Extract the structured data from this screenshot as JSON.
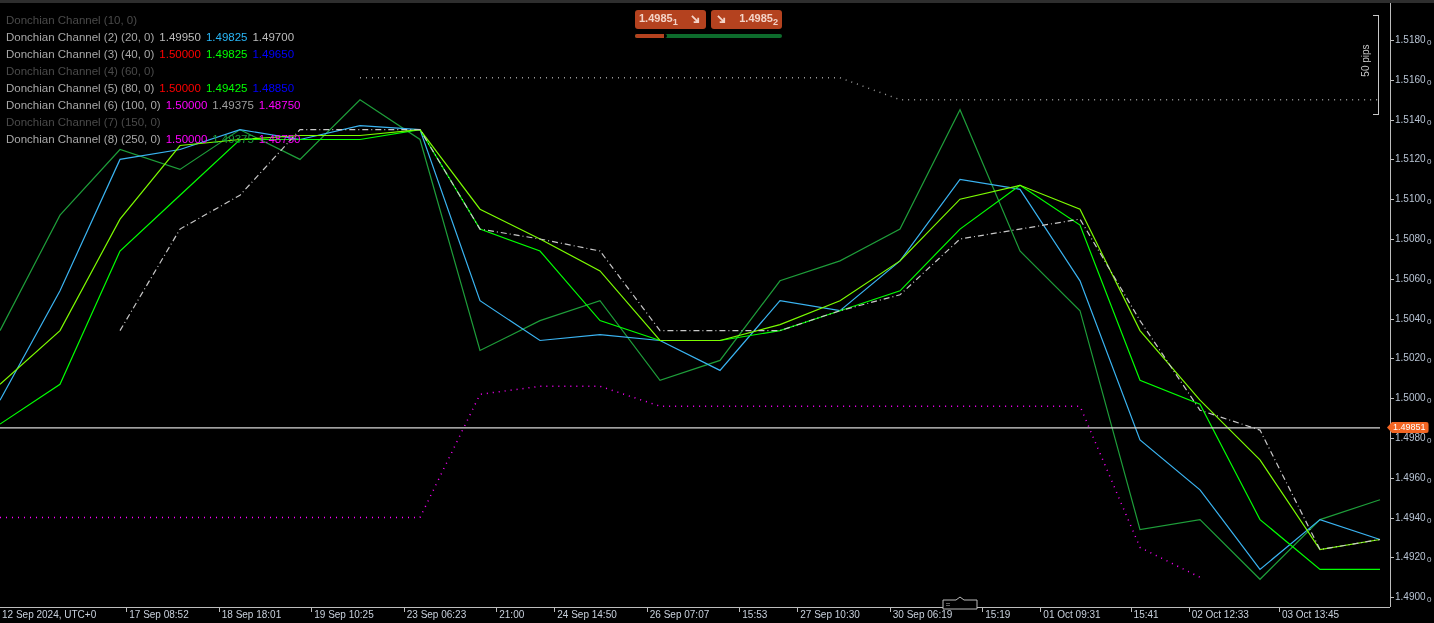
{
  "legend": [
    {
      "label": "Donchian Channel (10, 0)",
      "hidden": true
    },
    {
      "label": "Donchian Channel (2) (20, 0)",
      "hidden": false,
      "values": [
        {
          "text": "1.49950",
          "color": "#bdbdbd"
        },
        {
          "text": "1.49825",
          "color": "#29b6f6"
        },
        {
          "text": "1.49700",
          "color": "#bdbdbd"
        }
      ]
    },
    {
      "label": "Donchian Channel (3) (40, 0)",
      "hidden": false,
      "values": [
        {
          "text": "1.50000",
          "color": "#ff0000"
        },
        {
          "text": "1.49825",
          "color": "#00ff00"
        },
        {
          "text": "1.49650",
          "color": "#0000ff"
        }
      ]
    },
    {
      "label": "Donchian Channel (4) (60, 0)",
      "hidden": true
    },
    {
      "label": "Donchian Channel (5) (80, 0)",
      "hidden": false,
      "values": [
        {
          "text": "1.50000",
          "color": "#ff0000"
        },
        {
          "text": "1.49425",
          "color": "#00ff00"
        },
        {
          "text": "1.48850",
          "color": "#0000ff"
        }
      ]
    },
    {
      "label": "Donchian Channel (6) (100, 0)",
      "hidden": false,
      "values": [
        {
          "text": "1.50000",
          "color": "#ff00ff"
        },
        {
          "text": "1.49375",
          "color": "#9e9e9e"
        },
        {
          "text": "1.48750",
          "color": "#ff00ff"
        }
      ]
    },
    {
      "label": "Donchian Channel (7) (150, 0)",
      "hidden": true
    },
    {
      "label": "Donchian Channel (8) (250, 0)",
      "hidden": false,
      "values": [
        {
          "text": "1.50000",
          "color": "#ff00ff"
        },
        {
          "text": "1.49375",
          "color": "#1a9e3a"
        },
        {
          "text": "1.48750",
          "color": "#ff00ff"
        }
      ]
    }
  ],
  "trade_buttons": [
    {
      "kind": "sell",
      "price": "1.4985$_{1}$"
    },
    {
      "kind": "buy",
      "price": "1.4985$_{2}$"
    }
  ],
  "sentiment": {
    "level": 0.22
  },
  "ruler": {
    "label": "50 pips"
  },
  "price_axis_pipettes": [
    "0",
    "0",
    "0",
    "0",
    "0",
    "0",
    "0",
    "0",
    "0",
    "0",
    "0",
    "0",
    "0",
    "0",
    "0"
  ],
  "time_axis": [
    "12 Sep 2024, UTC+0",
    "17 Sep 08:52",
    "18 Sep 18:01",
    "19 Sep 10:25",
    "23 Sep 06:23",
    "21:00",
    "24 Sep 14:50",
    "26 Sep 07:07",
    "15:53",
    "27 Sep 10:30",
    "30 Sep 06:19",
    "15:19",
    "01 Oct 09:31",
    "15:41",
    "02 Oct 12:33",
    "03 Oct 13:45"
  ],
  "chart_data": {
    "type": "line",
    "categories": [
      null,
      null,
      null,
      null,
      null,
      null,
      null,
      null,
      null,
      null,
      null,
      null,
      null,
      null,
      null,
      null,
      null,
      null,
      null,
      null,
      null,
      null,
      null,
      null
    ],
    "ylim": [
      1.48951,
      1.51986
    ],
    "series": [
      {
        "color": "#1e9e3a",
        "values": [
          1.5034,
          1.5092,
          1.5125,
          1.5115,
          1.5135,
          1.512,
          1.515,
          1.513,
          1.5024,
          1.5039,
          1.5049,
          1.5009,
          1.5019,
          1.5059,
          1.5069,
          1.5085,
          1.5145,
          1.5074,
          1.5044,
          1.4934,
          1.4939,
          1.4909,
          1.4939,
          1.4949
        ]
      },
      {
        "color": "#3ab4f2",
        "values": [
          1.4999,
          1.5054,
          1.512,
          1.5125,
          1.5135,
          1.513,
          1.5137,
          1.5135,
          1.5049,
          1.5029,
          1.5032,
          1.5029,
          1.5014,
          1.5049,
          1.5044,
          1.5069,
          1.511,
          1.5105,
          1.5059,
          1.4979,
          1.4954,
          1.4914,
          1.4939,
          1.4929
        ]
      },
      {
        "color": "#00ff00",
        "values": [
          1.4987,
          1.5007,
          1.5074,
          1.5102,
          1.513,
          1.513,
          1.513,
          1.5135,
          1.5085,
          1.5074,
          1.5039,
          1.5029,
          1.5029,
          1.5034,
          1.5044,
          1.5054,
          1.5085,
          1.5107,
          1.5087,
          1.5009,
          1.4997,
          1.4939,
          1.4914,
          1.4914
        ]
      },
      {
        "color": "#7cfc00",
        "values": [
          1.5007,
          1.5034,
          1.509,
          1.5127,
          1.513,
          1.5132,
          1.5132,
          1.5135,
          1.5095,
          1.508,
          1.5064,
          1.5029,
          1.5029,
          1.5037,
          1.5049,
          1.5069,
          1.51,
          1.5107,
          1.5095,
          1.5034,
          1.4999,
          1.4969,
          1.4924,
          1.4929
        ]
      },
      {
        "color": "#c8c8c8",
        "line_style": "dashed",
        "values": [
          null,
          null,
          1.5034,
          1.5085,
          1.5102,
          1.5135,
          1.5135,
          1.5135,
          1.5085,
          1.508,
          1.5074,
          1.5034,
          1.5034,
          1.5034,
          1.5044,
          1.5052,
          1.508,
          1.5085,
          1.509,
          1.5039,
          1.4994,
          1.4984,
          1.4924,
          1.4929
        ]
      },
      {
        "color": "#9a9a9a",
        "line_style": "dotted",
        "values": [
          null,
          null,
          null,
          null,
          null,
          null,
          1.5161,
          1.5161,
          1.5161,
          1.5161,
          1.5161,
          1.5161,
          1.5161,
          1.5161,
          1.5161,
          1.515,
          1.515,
          1.515,
          1.515,
          1.515,
          1.515,
          1.515,
          1.515,
          1.515
        ]
      },
      {
        "color": "#ff00ff",
        "line_style": "dotted",
        "values": [
          1.494,
          1.494,
          1.494,
          1.494,
          1.494,
          1.494,
          1.494,
          1.494,
          1.5002,
          1.5006,
          1.5006,
          1.4996,
          1.4996,
          1.4996,
          1.4996,
          1.4996,
          1.4996,
          1.4996,
          1.4996,
          1.4925,
          1.491,
          null,
          null,
          null
        ]
      },
      {
        "color": "#d8d8d8",
        "values": [
          1.49851,
          1.49851,
          1.49851,
          1.49851,
          1.49851,
          1.49851,
          1.49851,
          1.49851,
          1.49851,
          1.49851,
          1.49851,
          1.49851,
          1.49851,
          1.49851,
          1.49851,
          1.49851,
          1.49851,
          1.49851,
          1.49851,
          1.49851,
          1.49851,
          1.49851,
          1.49851,
          1.49851
        ]
      }
    ],
    "yticks": [
      {
        "value": 1.518,
        "label": "1.5180"
      },
      {
        "value": 1.516,
        "label": "1.5160"
      },
      {
        "value": 1.514,
        "label": "1.5140"
      },
      {
        "value": 1.512,
        "label": "1.5120"
      },
      {
        "value": 1.51,
        "label": "1.5100"
      },
      {
        "value": 1.508,
        "label": "1.5080"
      },
      {
        "value": 1.506,
        "label": "1.5060"
      },
      {
        "value": 1.504,
        "label": "1.5040"
      },
      {
        "value": 1.502,
        "label": "1.5020"
      },
      {
        "value": 1.5,
        "label": "1.5000"
      },
      {
        "value": 1.498,
        "label": "1.4980"
      },
      {
        "value": 1.496,
        "label": "1.4960"
      },
      {
        "value": 1.494,
        "label": "1.4940"
      },
      {
        "value": 1.492,
        "label": "1.4920"
      },
      {
        "value": 1.49,
        "label": "1.4900"
      }
    ]
  },
  "current_price_badge": "1.49851"
}
